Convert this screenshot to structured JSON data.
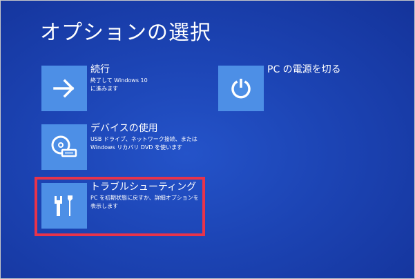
{
  "title": "オプションの選択",
  "options": [
    {
      "title": "続行",
      "description": "終了して Windows 10\nに進みます",
      "icon": "arrow-right-icon"
    },
    {
      "title": "デバイスの使用",
      "description": "USB ドライブ、ネットワーク接続、または\nWindows リカバリ DVD を使います",
      "icon": "disc-drive-icon"
    },
    {
      "title": "トラブルシューティング",
      "description": "PC を初期状態に戻すか、詳細オプションを\n表示します",
      "icon": "tools-icon"
    },
    {
      "title": "PC の電源を切る",
      "description": "",
      "icon": "power-icon"
    }
  ],
  "colors": {
    "background": "#1c44b4",
    "tile": "#4d8fe6",
    "highlight": "#e8334a"
  }
}
